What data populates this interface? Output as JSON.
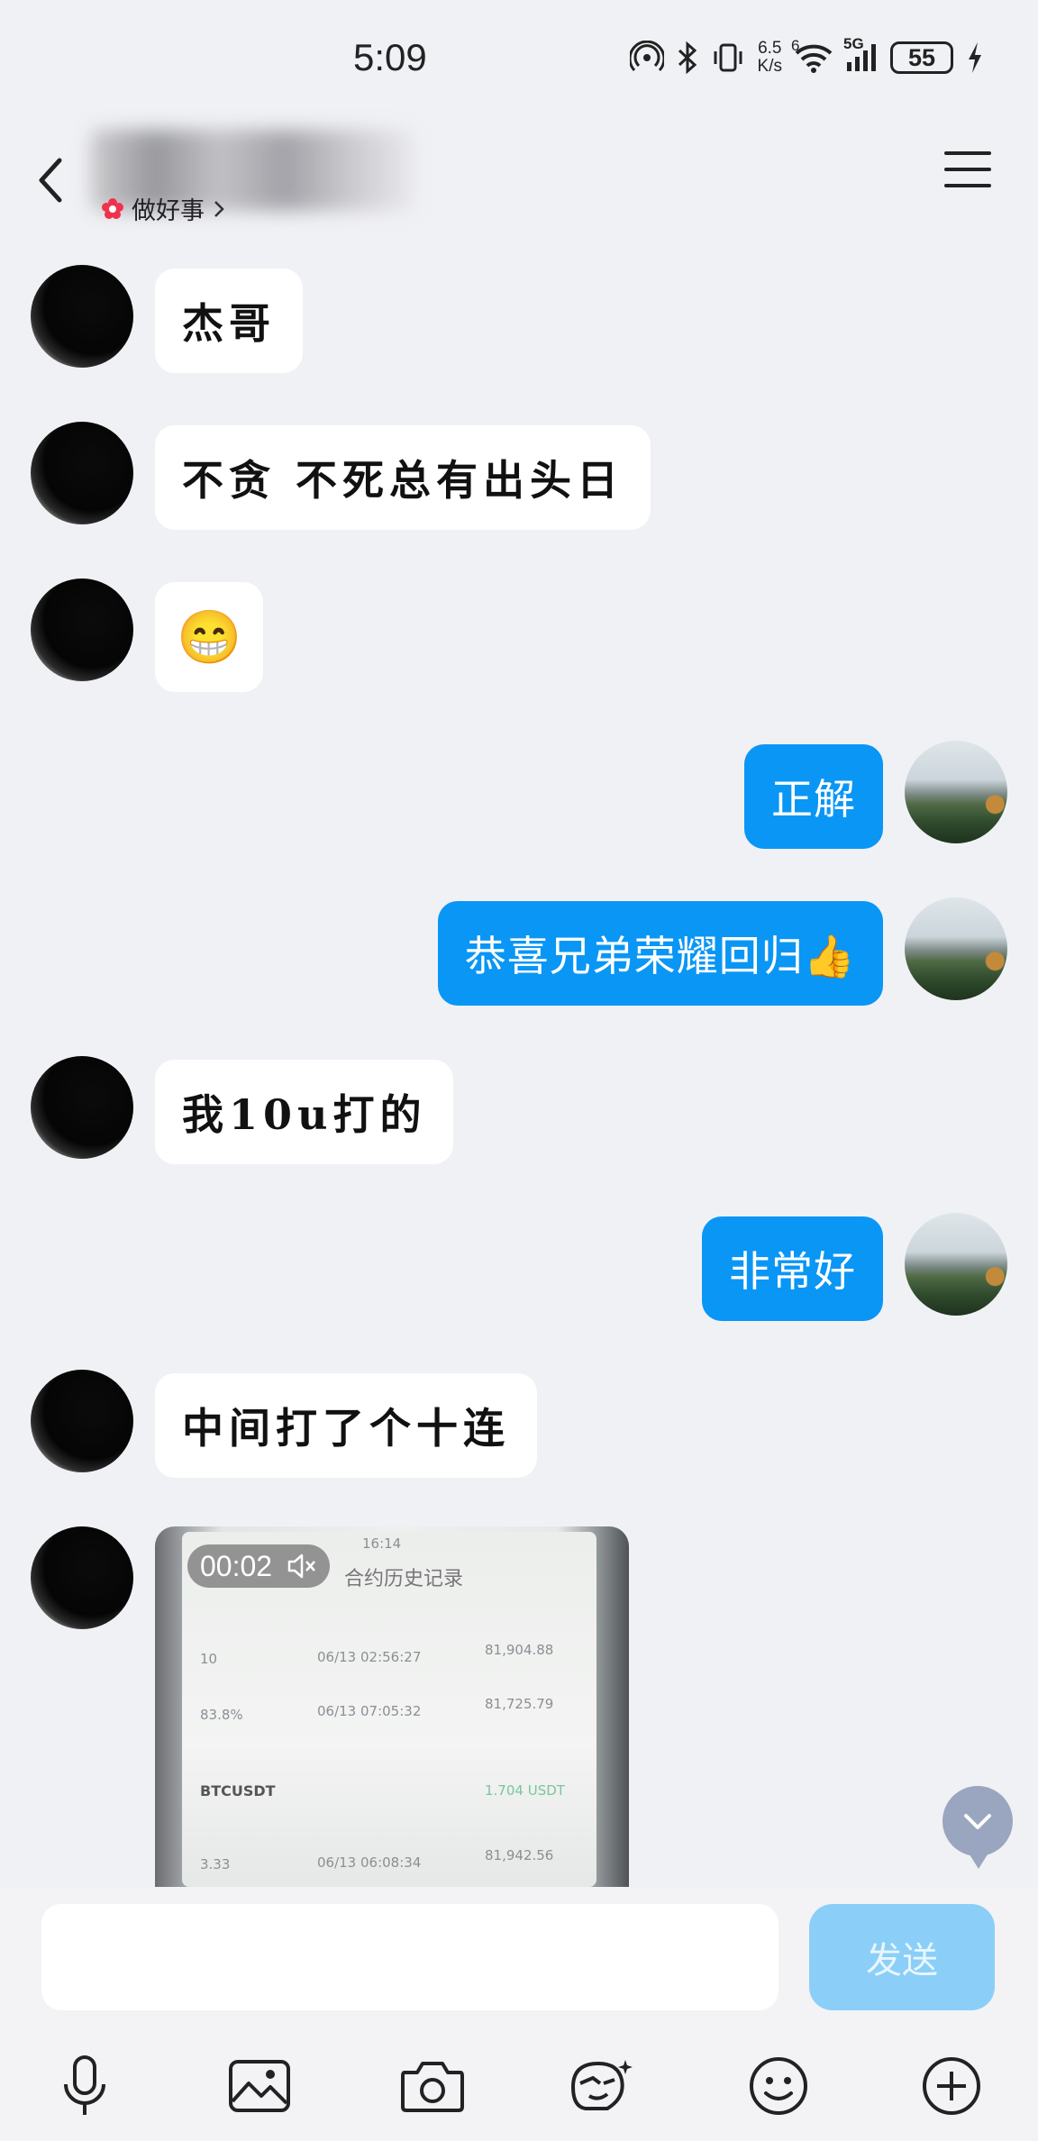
{
  "status_bar": {
    "time": "5:09",
    "net_speed_value": "6.5",
    "net_speed_unit": "K/s",
    "network": "5G",
    "wifi_label": "6",
    "battery": "55"
  },
  "header": {
    "contact_tag": "做好事"
  },
  "messages": [
    {
      "side": "left",
      "type": "text",
      "text": "杰哥"
    },
    {
      "side": "left",
      "type": "text",
      "text": "不贪 不死总有出头日"
    },
    {
      "side": "left",
      "type": "emoji",
      "text": "😁"
    },
    {
      "side": "right",
      "type": "text",
      "text": "正解"
    },
    {
      "side": "right",
      "type": "text",
      "text": "恭喜兄弟荣耀回归👍"
    },
    {
      "side": "left",
      "type": "text",
      "text": "我10u打的"
    },
    {
      "side": "right",
      "type": "text",
      "text": "非常好"
    },
    {
      "side": "left",
      "type": "text",
      "text": "中间打了个十连"
    },
    {
      "side": "left",
      "type": "video",
      "duration": "00:02"
    }
  ],
  "video_screen": {
    "clock": "16:14",
    "title": "合约历史记录",
    "symbol": "BTCUSDT",
    "value1": "1.704 USDT",
    "price1": "81,904.88",
    "price2": "81,725.79",
    "price3": "81,942.56",
    "time1": "06/13 02:56:27",
    "time2": "06/13 07:05:32",
    "time3": "06/13 06:08:34",
    "lev": "10",
    "pct": "83.8%",
    "num": "3.33"
  },
  "composer": {
    "input_value": "",
    "send_label": "发送"
  },
  "toolbar": [
    "microphone-icon",
    "image-icon",
    "camera-icon",
    "sticker-icon",
    "emoji-icon",
    "plus-icon"
  ]
}
